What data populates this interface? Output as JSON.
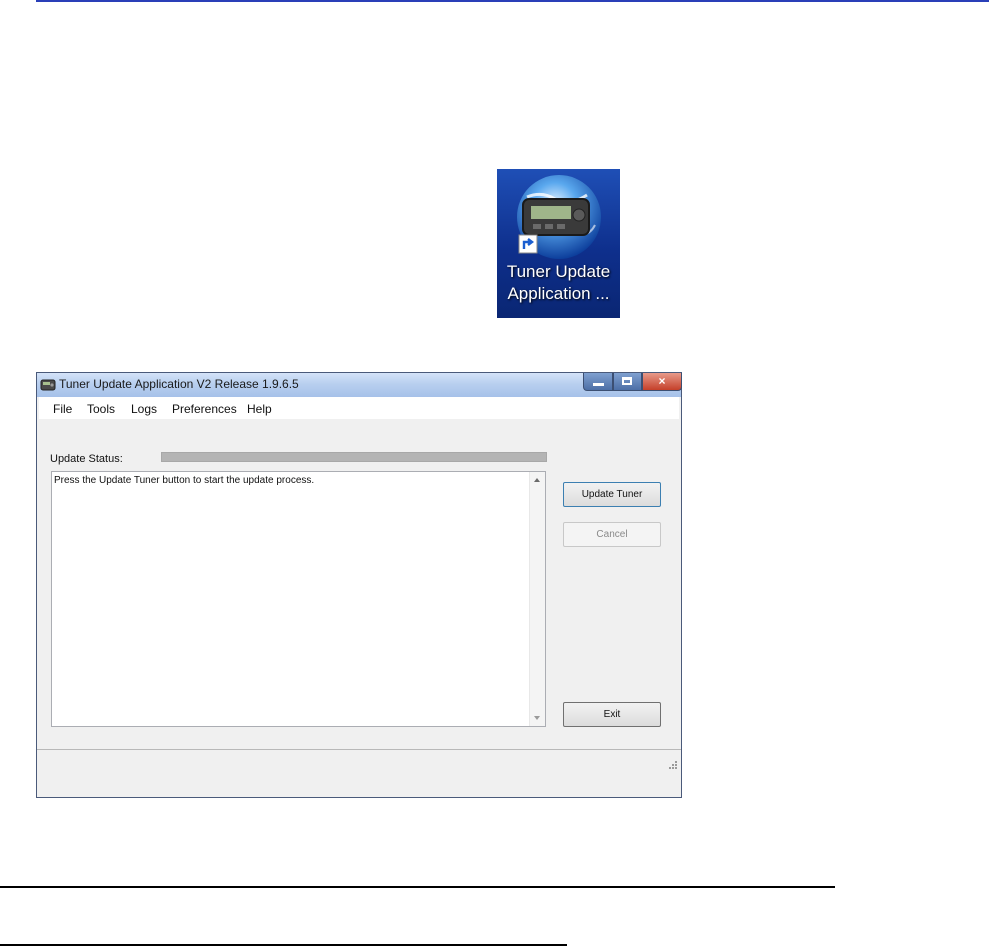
{
  "desktop_icon": {
    "caption_line1": "Tuner Update",
    "caption_line2": "Application ...",
    "icon": "tuner-globe-icon"
  },
  "window": {
    "title": "Tuner Update Application V2 Release 1.9.6.5",
    "app_icon": "tuner-device-icon",
    "controls": {
      "minimize": "minimize-icon",
      "maximize": "maximize-icon",
      "close": "×"
    },
    "menu": [
      {
        "label": "File"
      },
      {
        "label": "Tools"
      },
      {
        "label": "Logs"
      },
      {
        "label": "Preferences"
      },
      {
        "label": "Help"
      }
    ],
    "status_label": "Update Status:",
    "progress": 0,
    "log_text": "Press the Update Tuner button to start the update process.",
    "buttons": {
      "update": "Update Tuner",
      "cancel": "Cancel",
      "exit": "Exit"
    }
  },
  "colors": {
    "rule_top": "#2a3fb8",
    "icon_bg": "#1f4fb6",
    "titlebar": "#b8cfef",
    "close_button": "#c5402a",
    "progress_track": "#b4b4b4"
  }
}
